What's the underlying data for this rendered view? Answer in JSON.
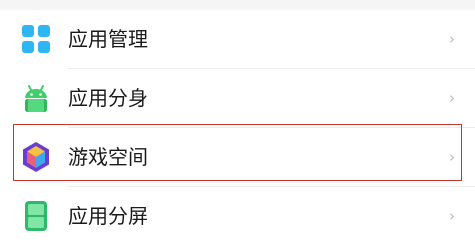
{
  "items": [
    {
      "label": "应用管理",
      "icon": "app-manage-grid-icon",
      "chevron": "›"
    },
    {
      "label": "应用分身",
      "icon": "android-clone-icon",
      "chevron": "›"
    },
    {
      "label": "游戏空间",
      "icon": "game-space-cube-icon",
      "chevron": "›"
    },
    {
      "label": "应用分屏",
      "icon": "split-screen-phone-icon",
      "chevron": "›"
    }
  ],
  "colors": {
    "highlight_border": "#c0392b",
    "grid_icon": "#2fb5f0",
    "android_icon": "#3ecf6a",
    "game_icon": "#6a3fd0",
    "split_icon": "#35c57a"
  }
}
